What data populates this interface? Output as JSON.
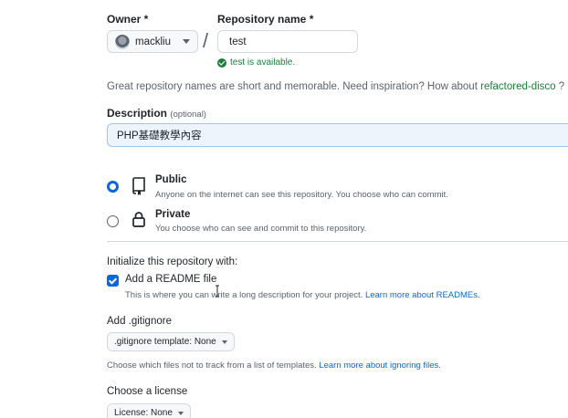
{
  "owner": {
    "label": "Owner *",
    "value": "mackliu",
    "avatar_icon": "owner-avatar"
  },
  "separator": "/",
  "repo_name": {
    "label": "Repository name *",
    "value": "test",
    "availability": "test is available."
  },
  "hint": {
    "prefix": "Great repository names are short and memorable. Need inspiration? How about ",
    "suggestion": "refactored-disco",
    "suffix": " ?"
  },
  "description": {
    "label": "Description",
    "optional": "(optional)",
    "value": "PHP基礎教學內容"
  },
  "visibility": {
    "public": {
      "title": "Public",
      "desc": "Anyone on the internet can see this repository. You choose who can commit.",
      "selected": true,
      "icon": "repo-icon"
    },
    "private": {
      "title": "Private",
      "desc": "You choose who can see and commit to this repository.",
      "selected": false,
      "icon": "lock-icon"
    }
  },
  "initialize": {
    "heading": "Initialize this repository with:",
    "readme": {
      "label": "Add a README file",
      "checked": true,
      "desc_prefix": "This is where you can write a long description for your project. ",
      "link": "Learn more about READMEs."
    }
  },
  "gitignore": {
    "heading": "Add .gitignore",
    "dropdown": ".gitignore template: None",
    "desc_prefix": "Choose which files not to track from a list of templates. ",
    "link": "Learn more about ignoring files."
  },
  "license": {
    "heading": "Choose a license",
    "dropdown": "License: None"
  },
  "colors": {
    "accent": "#0969da",
    "success": "#1a7f37",
    "muted": "#59636e"
  }
}
